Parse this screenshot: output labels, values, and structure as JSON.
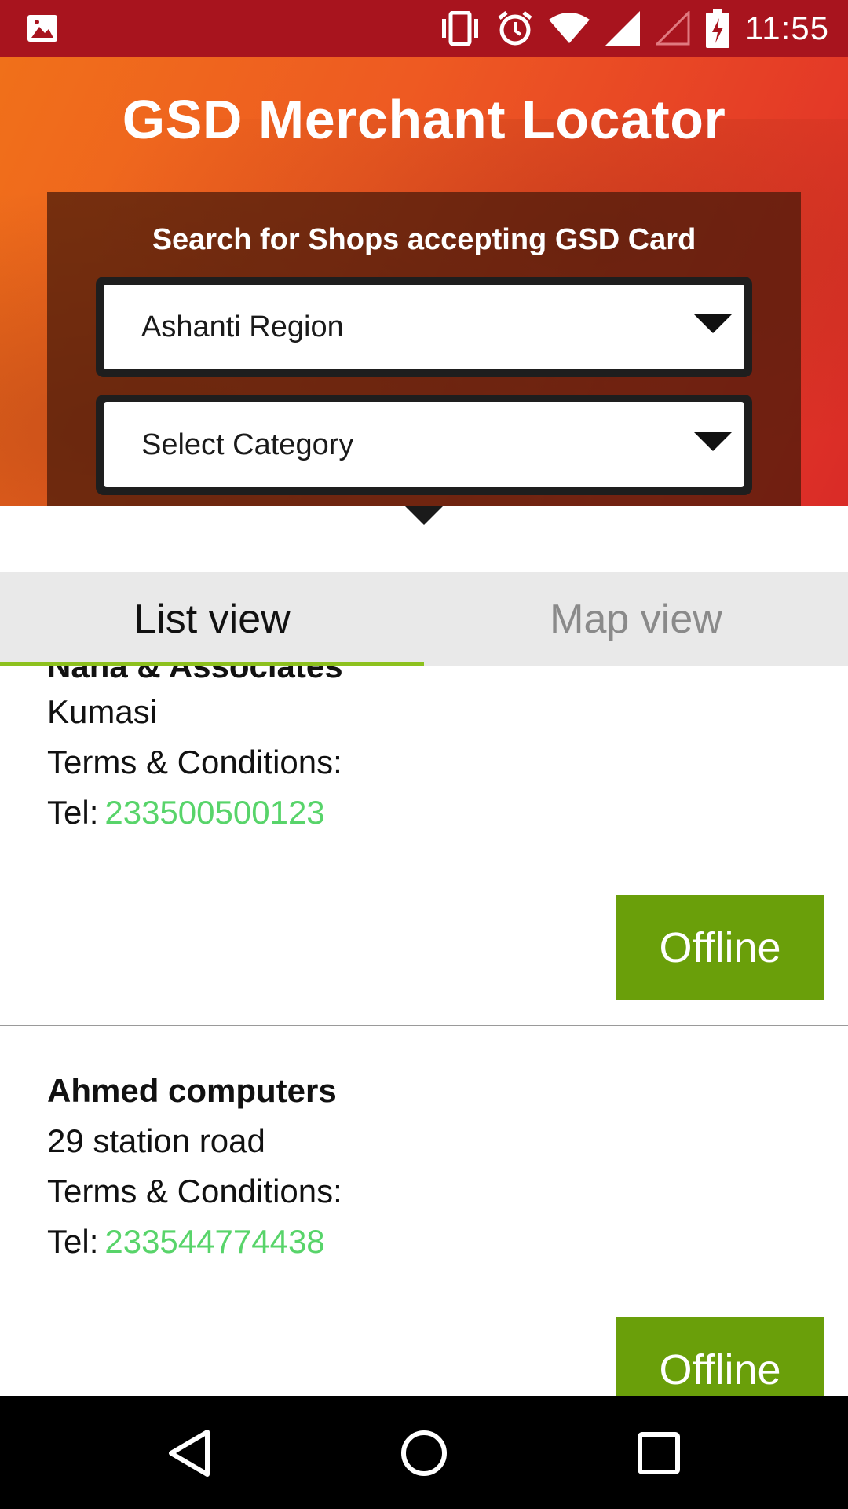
{
  "status_bar": {
    "time": "11:55"
  },
  "header": {
    "title": "GSD Merchant Locator",
    "search_heading": "Search for Shops accepting GSD Card",
    "region_select": {
      "value": "Ashanti Region"
    },
    "category_select": {
      "value": "Select Category"
    }
  },
  "tabs": [
    {
      "label": "List view",
      "active": true
    },
    {
      "label": "Map view",
      "active": false
    }
  ],
  "merchants": [
    {
      "name": "Nana & Associates",
      "address": "Kumasi",
      "terms_label": "Terms & Conditions:",
      "tel_label": "Tel:",
      "tel": "233500500123",
      "status": "Offline"
    },
    {
      "name": "Ahmed computers",
      "address": "29 station road",
      "terms_label": "Terms & Conditions:",
      "tel_label": "Tel:",
      "tel": "233544774438",
      "status": "Offline"
    }
  ],
  "colors": {
    "status_bar": "#a8141e",
    "tab_indicator": "#8dc11e",
    "offline_button": "#6a9f0a",
    "phone_link": "#58d46a"
  },
  "icons": {
    "status_left": "image-notification-icon",
    "status_right": [
      "vibrate-icon",
      "alarm-icon",
      "wifi-icon",
      "signal-icon",
      "no-signal-icon",
      "battery-charging-icon"
    ],
    "nav": [
      "back-icon",
      "home-icon",
      "recents-icon"
    ]
  }
}
